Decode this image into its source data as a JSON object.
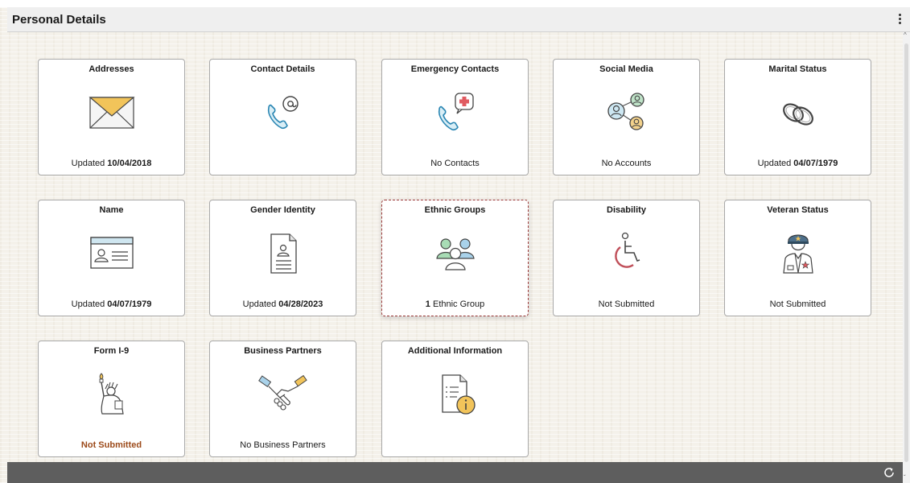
{
  "header": {
    "title": "Personal Details",
    "menu_icon": "kebab-menu-icon"
  },
  "tiles": [
    {
      "title": "Addresses",
      "icon": "envelope-icon",
      "status_prefix": "Updated",
      "status_value": "10/04/2018"
    },
    {
      "title": "Contact Details",
      "icon": "phone-at-icon",
      "status_prefix": "",
      "status_value": ""
    },
    {
      "title": "Emergency Contacts",
      "icon": "emergency-phone-icon",
      "status_prefix": "No Contacts",
      "status_value": ""
    },
    {
      "title": "Social Media",
      "icon": "social-network-icon",
      "status_prefix": "No Accounts",
      "status_value": ""
    },
    {
      "title": "Marital Status",
      "icon": "rings-icon",
      "status_prefix": "Updated",
      "status_value": "04/07/1979"
    },
    {
      "title": "Name",
      "icon": "id-card-icon",
      "status_prefix": "Updated",
      "status_value": "04/07/1979"
    },
    {
      "title": "Gender Identity",
      "icon": "profile-document-icon",
      "status_prefix": "Updated",
      "status_value": "04/28/2023"
    },
    {
      "title": "Ethnic Groups",
      "icon": "people-group-icon",
      "status_prefix": "Ethnic Group",
      "status_value": "1"
    },
    {
      "title": "Disability",
      "icon": "wheelchair-icon",
      "status_prefix": "Not Submitted",
      "status_value": ""
    },
    {
      "title": "Veteran Status",
      "icon": "veteran-officer-icon",
      "status_prefix": "Not Submitted",
      "status_value": ""
    },
    {
      "title": "Form I-9",
      "icon": "statue-of-liberty-icon",
      "status_prefix": "Not Submitted",
      "status_value": ""
    },
    {
      "title": "Business Partners",
      "icon": "handshake-icon",
      "status_prefix": "No Business Partners",
      "status_value": ""
    },
    {
      "title": "Additional Information",
      "icon": "document-info-icon",
      "status_prefix": "",
      "status_value": ""
    }
  ],
  "footer": {
    "refresh_icon": "refresh-icon"
  },
  "colors": {
    "header_bg": "#efefef",
    "footer_bg": "#5e5e5e",
    "alert_text": "#9c4a1a",
    "focus_border": "#9b3a3a"
  }
}
